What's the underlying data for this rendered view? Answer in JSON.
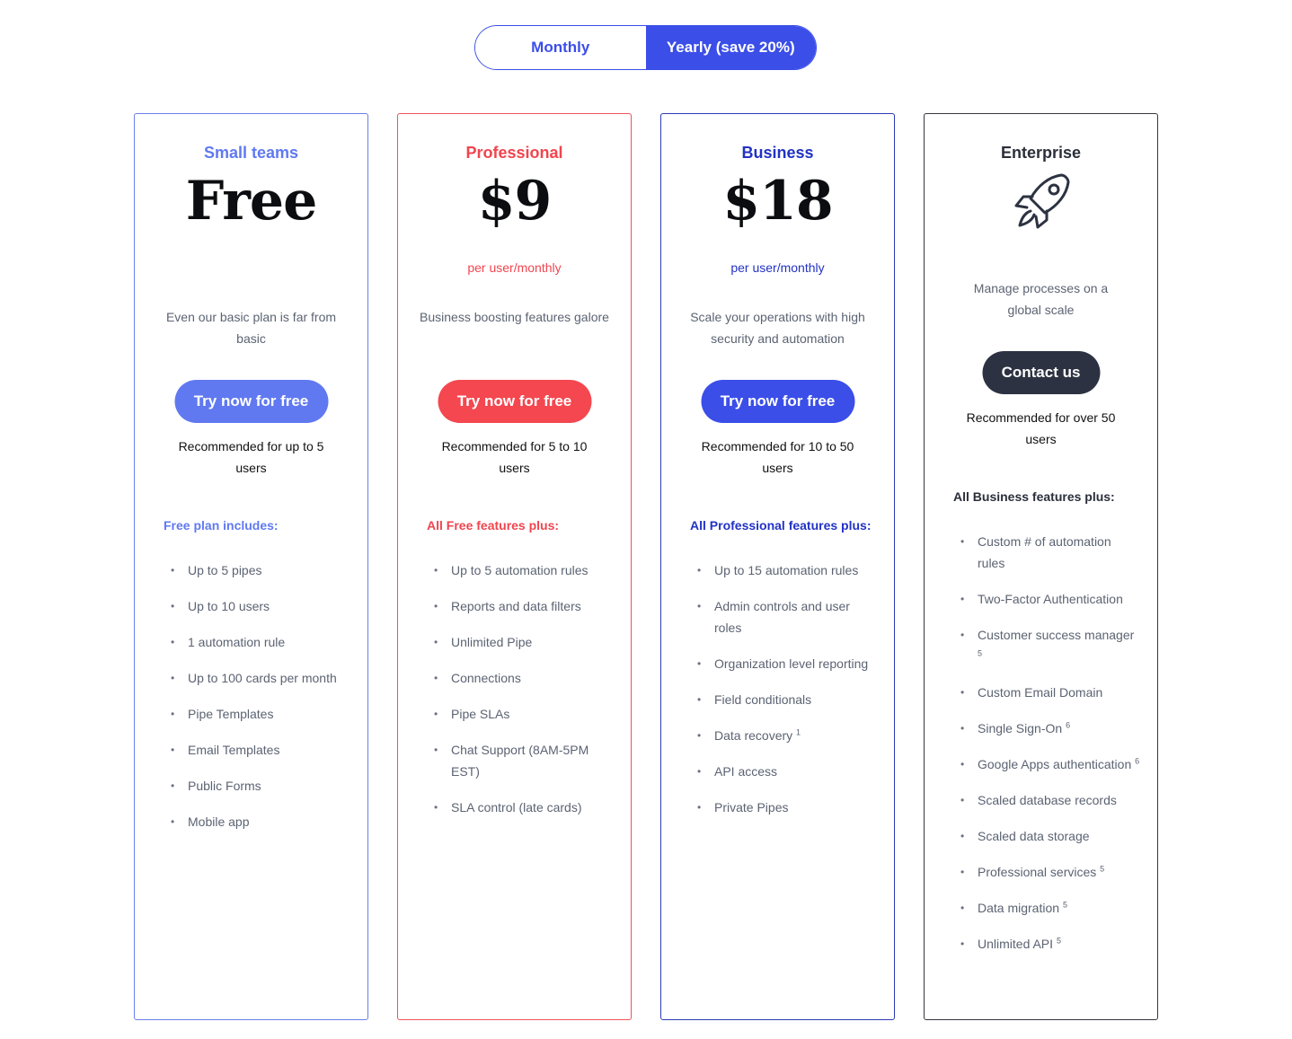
{
  "toggle": {
    "monthly": "Monthly",
    "yearly": "Yearly (save 20%)"
  },
  "plans": [
    {
      "name": "Small teams",
      "price": "Free",
      "per": "",
      "description": "Even our basic plan is far from basic",
      "cta": "Try now for free",
      "recommendation": "Recommended for up to 5 users",
      "features_title": "Free plan includes:",
      "features": [
        "Up to 5 pipes",
        "Up to 10 users",
        "1 automation rule",
        "Up to 100 cards per month",
        "Pipe Templates",
        "Email Templates",
        "Public Forms",
        "Mobile app"
      ]
    },
    {
      "name": "Professional",
      "price": "$9",
      "per": "per user/monthly",
      "description": "Business boosting features galore",
      "cta": "Try now for free",
      "recommendation": "Recommended for 5 to 10 users",
      "features_title": "All Free features plus:",
      "features": [
        "Up to 5 automation rules",
        "Reports and data filters",
        "Unlimited Pipe",
        "Connections",
        "Pipe SLAs",
        "Chat Support (8AM-5PM EST)",
        "SLA control (late cards)"
      ]
    },
    {
      "name": "Business",
      "price": "$18",
      "per": "per user/monthly",
      "description": "Scale your operations with high security and automation",
      "cta": "Try now for free",
      "recommendation": "Recommended for 10 to 50 users",
      "features_title": "All Professional features plus:",
      "features": [
        "Up to 15 automation rules",
        "Admin controls and user roles",
        "Organization level reporting",
        "Field conditionals",
        "Data recovery",
        "API access",
        "Private Pipes"
      ],
      "feature_notes": [
        "",
        "",
        "",
        "",
        "1",
        "",
        ""
      ]
    },
    {
      "name": "Enterprise",
      "icon": "rocket-icon",
      "description": "Manage processes on a global scale",
      "cta": "Contact us",
      "recommendation": "Recommended for over 50 users",
      "features_title": "All Business features plus:",
      "features": [
        "Custom # of automation rules",
        "Two-Factor Authentication",
        "Customer success manager",
        "Custom Email Domain",
        "Single Sign-On",
        "Google Apps authentication",
        "Scaled database records",
        "Scaled data storage",
        "Professional services",
        "Data migration",
        "Unlimited API"
      ],
      "feature_notes": [
        "",
        "",
        "5",
        "",
        "6",
        "6",
        "",
        "",
        "5",
        "5",
        "5"
      ]
    }
  ],
  "colors": {
    "small_teams": "#6079f0",
    "professional": "#f4474f",
    "business": "#3b4ee8",
    "enterprise": "#2c3241"
  }
}
